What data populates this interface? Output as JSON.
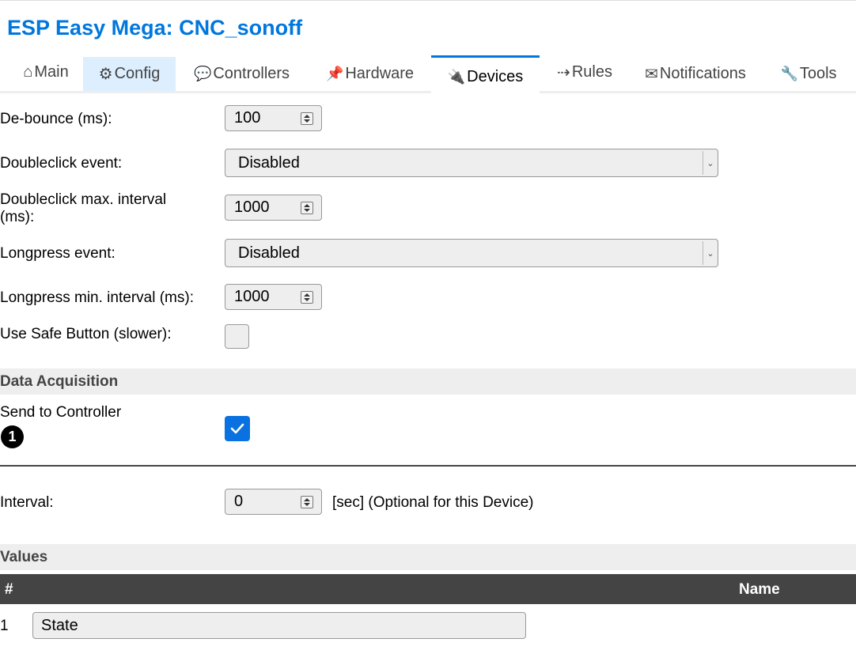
{
  "app": {
    "title": "ESP Easy Mega: CNC_sonoff"
  },
  "tabs": [
    {
      "icon": "⌂",
      "label": "Main"
    },
    {
      "icon": "⚙",
      "label": "Config"
    },
    {
      "icon": "💬",
      "label": "Controllers"
    },
    {
      "icon": "📌",
      "label": "Hardware"
    },
    {
      "icon": "🔌",
      "label": "Devices"
    },
    {
      "icon": "⇢",
      "label": "Rules"
    },
    {
      "icon": "✉",
      "label": "Notifications"
    },
    {
      "icon": "🔧",
      "label": "Tools"
    }
  ],
  "active_tab": "Devices",
  "form": {
    "debounce": {
      "label": "De-bounce (ms):",
      "value": "100"
    },
    "doubleclick": {
      "label": "Doubleclick event:",
      "value": "Disabled"
    },
    "doubleclick_interval": {
      "label_line1": "Doubleclick max. interval",
      "label_line2": "(ms):",
      "value": "1000"
    },
    "longpress": {
      "label": "Longpress event:",
      "value": "Disabled"
    },
    "longpress_interval": {
      "label": "Longpress min. interval (ms):",
      "value": "1000"
    },
    "safe_button": {
      "label": "Use Safe Button (slower):",
      "checked": false
    }
  },
  "data_acquisition": {
    "title": "Data Acquisition",
    "send_to_controller": {
      "label": "Send to Controller",
      "note_number": "1",
      "checked": true
    },
    "interval": {
      "label": "Interval:",
      "value": "0",
      "suffix": "[sec] (Optional for this Device)"
    }
  },
  "values": {
    "title": "Values",
    "columns": {
      "index": "#",
      "name": "Name"
    },
    "rows": [
      {
        "index": "1",
        "name": "State"
      }
    ]
  },
  "colors": {
    "accent": "#0077dd",
    "checkbox": "#0a72e0",
    "table_header": "#444444",
    "section_bg": "#eeeeee"
  }
}
